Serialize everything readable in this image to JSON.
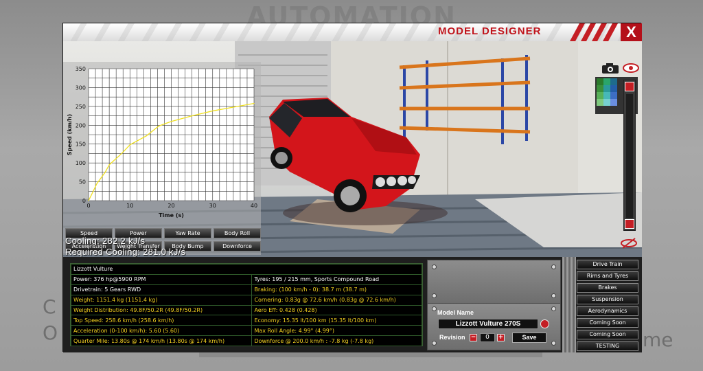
{
  "background": {
    "logo_text": "AUTOMATION",
    "menu_left": [
      "C",
      "O"
    ],
    "menu_right": "me"
  },
  "window": {
    "title": "MODEL DESIGNER",
    "close_label": "X"
  },
  "chart_data": {
    "type": "line",
    "xlabel": "Time (s)",
    "ylabel": "Speed (km/h)",
    "xlim": [
      0,
      40
    ],
    "ylim": [
      0,
      350
    ],
    "xticks": [
      0,
      10,
      20,
      30,
      40
    ],
    "yticks": [
      0,
      50,
      100,
      150,
      200,
      250,
      300,
      350
    ],
    "grid": true,
    "series": [
      {
        "color": "#f0e020",
        "x": [
          0,
          1,
          2,
          3,
          4,
          5,
          6,
          8,
          10,
          12,
          14,
          17,
          20,
          25,
          30,
          35,
          40
        ],
        "y": [
          0,
          22,
          45,
          60,
          75,
          95,
          105,
          125,
          148,
          160,
          172,
          198,
          210,
          225,
          238,
          248,
          258
        ]
      }
    ]
  },
  "chart_tabs": [
    [
      "Speed",
      "Power",
      "Yaw Rate",
      "Body Roll"
    ],
    [
      "Acceleration",
      "Weight Transfer",
      "Body Bump",
      "Downforce"
    ]
  ],
  "cooling": {
    "line1": "Cooling: 282.2 kJ/s",
    "line2": "Required Cooling: 281.0 kJ/s"
  },
  "stats": {
    "car_name": "Lizzott Vulture",
    "rows": [
      {
        "left": "Power: 376 hp@5900 RPM",
        "left_hl": false,
        "right": "Tyres: 195 / 215 mm, Sports Compound Road",
        "right_hl": false
      },
      {
        "left": "Drivetrain: 5 Gears RWD",
        "left_hl": false,
        "right": "Braking: (100 km/h - 0): 38.7 m (38.7 m)",
        "right_hl": true
      },
      {
        "left": "Weight: 1151.4 kg (1151.4 kg)",
        "left_hl": true,
        "right": "Cornering: 0.83g @ 72.6 km/h (0.83g @ 72.6 km/h)",
        "right_hl": true
      },
      {
        "left": "Weight Distribution: 49.8F/50.2R (49.8F/50.2R)",
        "left_hl": true,
        "right": "Aero Eff: 0.428 (0.428)",
        "right_hl": true
      },
      {
        "left": "Top Speed: 258.6 km/h (258.6 km/h)",
        "left_hl": true,
        "right": "Economy: 15.35 lt/100 km (15.35 lt/100 km)",
        "right_hl": true
      },
      {
        "left": "Acceleration (0-100 km/h): 5.60 (5.60)",
        "left_hl": true,
        "right": "Max Roll Angle: 4.99° (4.99°)",
        "right_hl": true
      },
      {
        "left": "Quarter Mile: 13.80s @ 174 km/h (13.80s @ 174 km/h)",
        "left_hl": true,
        "right": "Downforce @ 200.0 km/h : -7.8 kg (-7.8 kg)",
        "right_hl": true
      }
    ]
  },
  "model": {
    "label": "Model Name",
    "name": "Lizzott Vulture 270S",
    "revision_label": "Revision",
    "revision_value": "0",
    "minus_label": "−",
    "plus_label": "+",
    "save_label": "Save"
  },
  "side_menu": [
    "Drive Train",
    "Rims and Tyres",
    "Brakes",
    "Suspension",
    "Aerodynamics",
    "Coming Soon",
    "Coming Soon",
    "TESTING"
  ],
  "colors": {
    "accent_red": "#c0141c",
    "chart_line": "#f0e020",
    "stat_highlight": "#f2d020"
  }
}
